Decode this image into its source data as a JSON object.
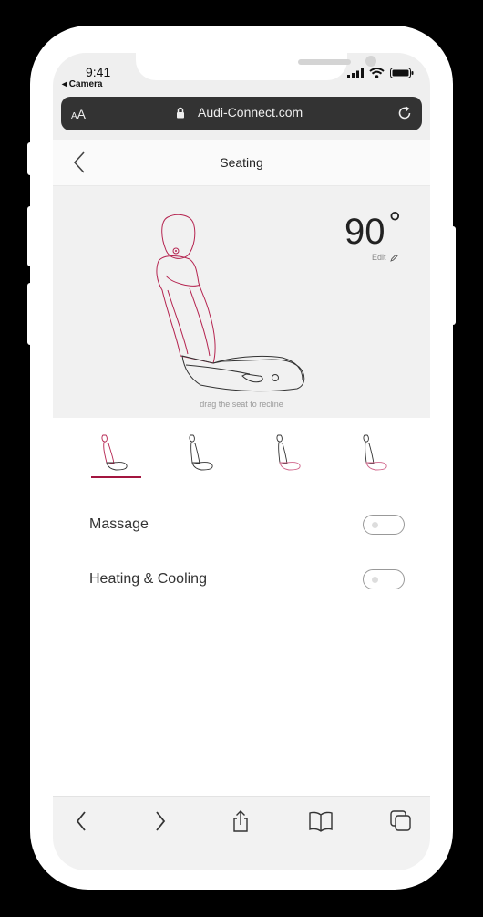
{
  "status_bar": {
    "time": "9:41",
    "back_app": "◂ Camera"
  },
  "browser": {
    "text_size_label_small": "A",
    "text_size_label_large": "A",
    "url": "Audi-Connect.com"
  },
  "header": {
    "title": "Seating"
  },
  "seat": {
    "angle_value": "90",
    "angle_unit": "°",
    "edit_label": "Edit",
    "drag_hint": "drag the seat to recline"
  },
  "presets": [
    {
      "name": "preset-1",
      "selected": true
    },
    {
      "name": "preset-2",
      "selected": false
    },
    {
      "name": "preset-3",
      "selected": false
    },
    {
      "name": "preset-4",
      "selected": false
    }
  ],
  "settings": [
    {
      "label": "Massage",
      "on": false
    },
    {
      "label": "Heating & Cooling",
      "on": false
    }
  ],
  "colors": {
    "accent": "#a3153f",
    "seat_line": "#b52450",
    "preset_pink": "#d0648a"
  },
  "toolbar_icons": [
    "chevron-left-icon",
    "chevron-right-icon",
    "share-icon",
    "bookmarks-icon",
    "tabs-icon"
  ]
}
